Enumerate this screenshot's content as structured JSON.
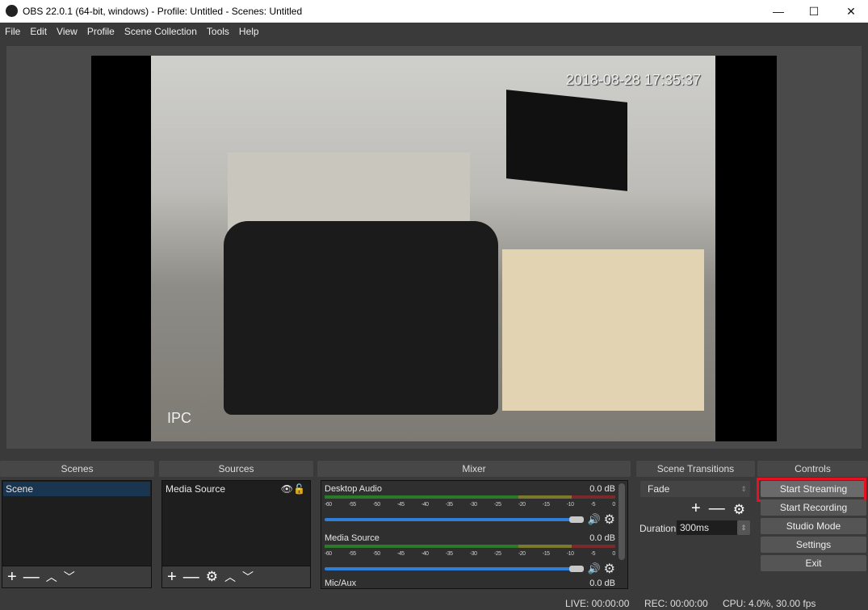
{
  "window": {
    "title": "OBS 22.0.1 (64-bit, windows) - Profile: Untitled - Scenes: Untitled",
    "minimize": "—",
    "maximize": "☐",
    "close": "✕"
  },
  "menu": [
    "File",
    "Edit",
    "View",
    "Profile",
    "Scene Collection",
    "Tools",
    "Help"
  ],
  "preview": {
    "timestamp": "2018-08-28 17:35:37",
    "overlay": "IPC"
  },
  "scenes": {
    "title": "Scenes",
    "items": [
      "Scene"
    ]
  },
  "sources": {
    "title": "Sources",
    "items": [
      "Media Source"
    ]
  },
  "mixer": {
    "title": "Mixer",
    "scale": [
      "-60",
      "-55",
      "-50",
      "-45",
      "-40",
      "-35",
      "-30",
      "-25",
      "-20",
      "-15",
      "-10",
      "-5",
      "0"
    ],
    "channels": [
      {
        "name": "Desktop Audio",
        "level": "0.0 dB",
        "volume": 1.0
      },
      {
        "name": "Media Source",
        "level": "0.0 dB",
        "volume": 1.0
      },
      {
        "name": "Mic/Aux",
        "level": "0.0 dB"
      }
    ]
  },
  "transitions": {
    "title": "Scene Transitions",
    "selected": "Fade",
    "duration_label": "Duration",
    "duration": "300ms"
  },
  "controls": {
    "title": "Controls",
    "buttons": [
      "Start Streaming",
      "Start Recording",
      "Studio Mode",
      "Settings",
      "Exit"
    ],
    "highlight": "#e81123"
  },
  "status": {
    "live": "LIVE: 00:00:00",
    "rec": "REC: 00:00:00",
    "cpu": "CPU: 4.0%, 30.00 fps"
  }
}
